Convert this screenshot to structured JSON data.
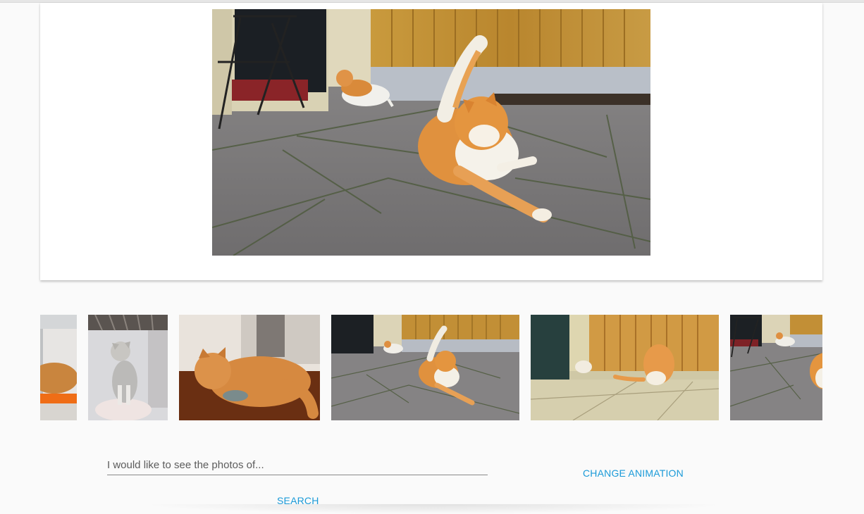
{
  "viewer": {
    "main_photo": {
      "subject": "orange-white-cats-on-patio"
    }
  },
  "carousel": {
    "thumbnails": [
      {
        "subject": "cat-on-orange-blanket-partial"
      },
      {
        "subject": "grey-white-cat-sitting"
      },
      {
        "subject": "orange-cat-sleeping-with-toy"
      },
      {
        "subject": "orange-white-cats-on-patio"
      },
      {
        "subject": "cats-by-wooden-fence"
      },
      {
        "subject": "cats-on-patio-partial"
      }
    ]
  },
  "search": {
    "placeholder": "I would like to see the photos of...",
    "button_label": "SEARCH"
  },
  "controls": {
    "change_animation_label": "CHANGE ANIMATION"
  },
  "colors": {
    "accent": "#1a9ad8",
    "background": "#fafafa",
    "card": "#ffffff"
  }
}
